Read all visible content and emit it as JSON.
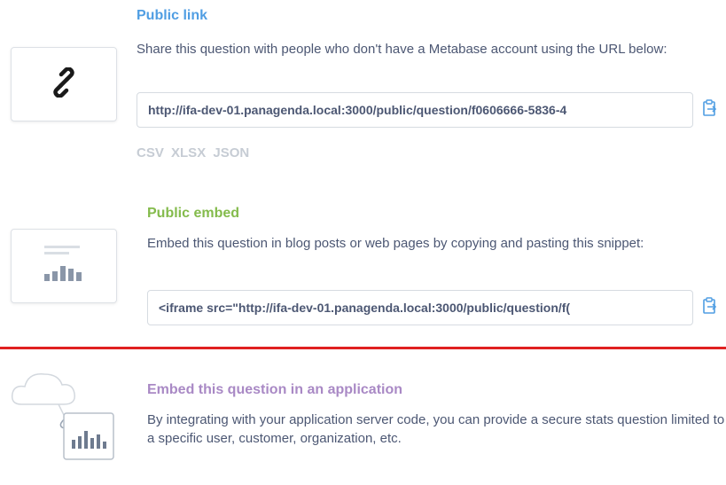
{
  "public_link": {
    "title": "Public link",
    "description": "Share this question with people who don't have a Metabase account using the URL below:",
    "url": "http://ifa-dev-01.panagenda.local:3000/public/question/f0606666-5836-4",
    "formats": [
      "CSV",
      "XLSX",
      "JSON"
    ],
    "title_color": "#509ee3"
  },
  "public_embed": {
    "title": "Public embed",
    "description": "Embed this question in blog posts or web pages by copying and pasting this snippet:",
    "snippet": "<iframe   src=\"http://ifa-dev-01.panagenda.local:3000/public/question/f(",
    "title_color": "#84bb4c"
  },
  "app_embed": {
    "title": "Embed this question in an application",
    "description": "By integrating with your application server code, you can provide a secure stats question limited to a specific user, customer, organization, etc.",
    "title_color": "#a989c5"
  },
  "icons": [
    "link-icon",
    "embed-chart-icon",
    "cloud-icon",
    "copy-icon"
  ],
  "divider_color": "#e02020"
}
